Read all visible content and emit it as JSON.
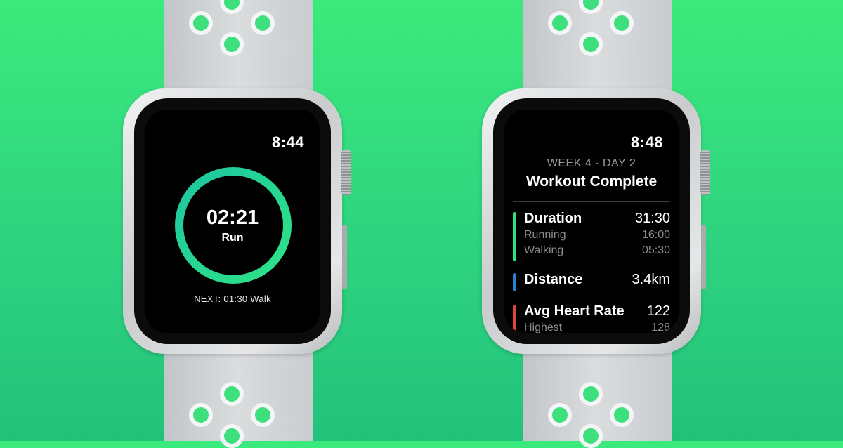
{
  "colors": {
    "background": "#35de7e",
    "ring_start": "#1ec6a0",
    "ring_end": "#2ee386",
    "duration_bar": "#2ee386",
    "distance_bar": "#2a7fd6",
    "heart_bar": "#e0453a"
  },
  "left_watch": {
    "time": "8:44",
    "timer": "02:21",
    "phase": "Run",
    "next": "NEXT: 01:30 Walk"
  },
  "right_watch": {
    "time": "8:48",
    "subtitle": "WEEK 4 - DAY 2",
    "title": "Workout Complete",
    "stats": [
      {
        "label": "Duration",
        "value": "31:30",
        "icon": "green-bar",
        "sub": [
          {
            "label": "Running",
            "value": "16:00"
          },
          {
            "label": "Walking",
            "value": "05:30"
          }
        ]
      },
      {
        "label": "Distance",
        "value": "3.4km",
        "icon": "blue-bar",
        "sub": []
      },
      {
        "label": "Avg Heart Rate",
        "value": "122",
        "icon": "red-bar",
        "sub": [
          {
            "label": "Highest",
            "value": "128"
          }
        ]
      }
    ]
  }
}
